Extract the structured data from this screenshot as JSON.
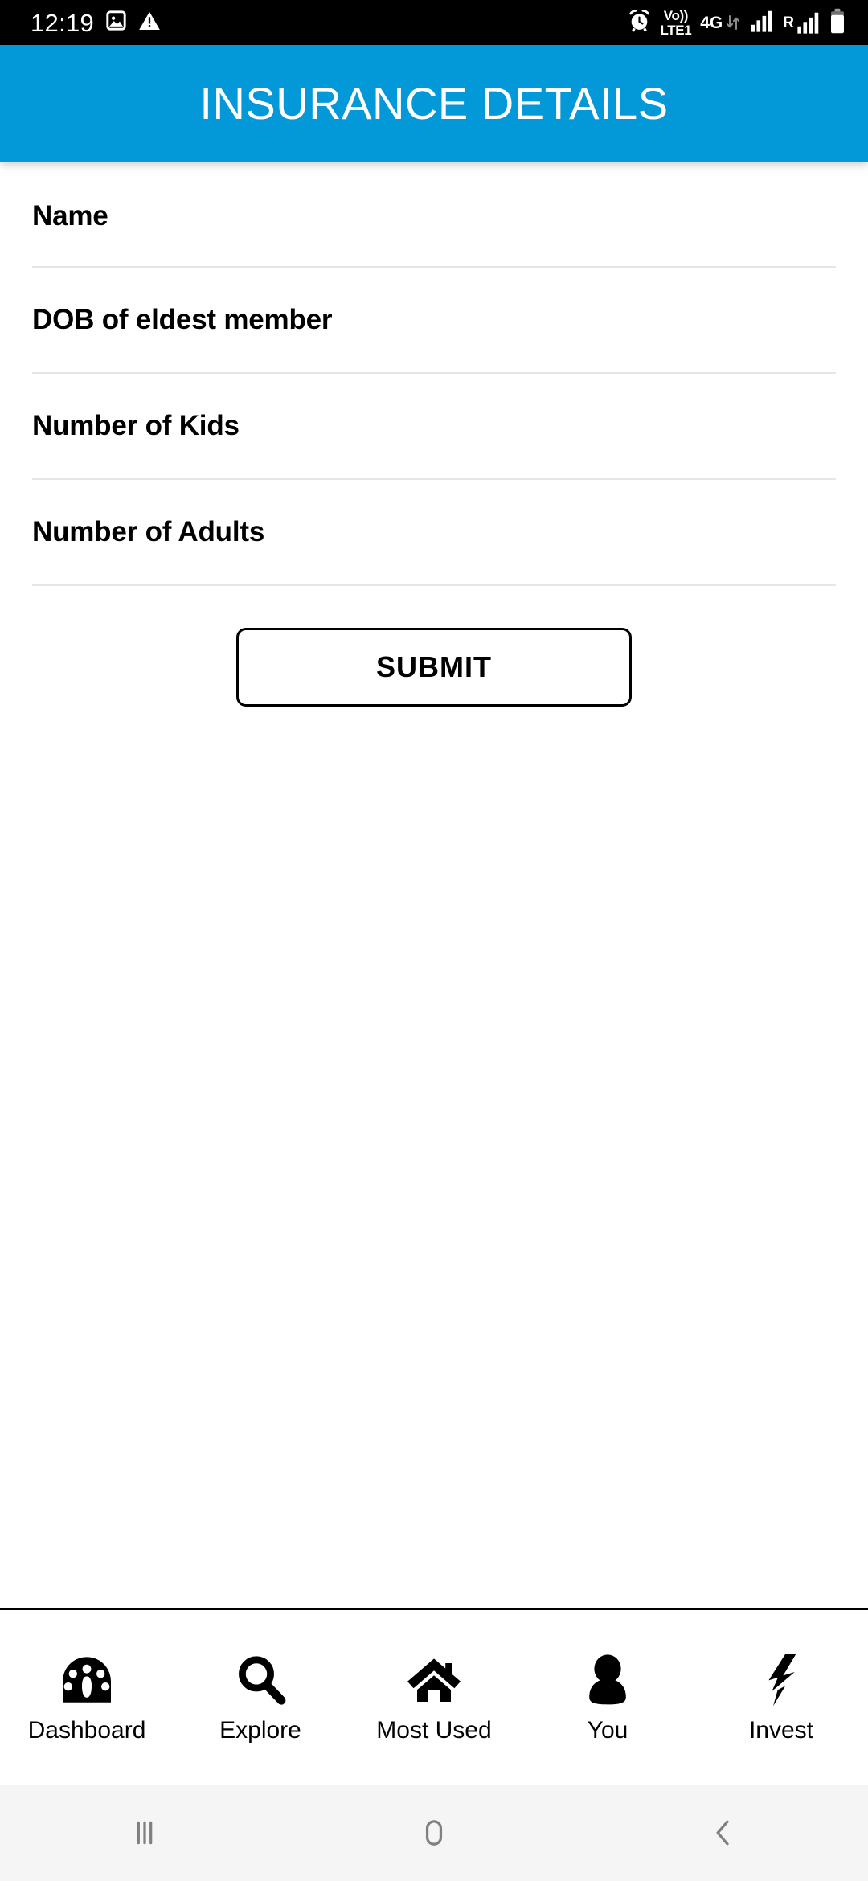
{
  "status_bar": {
    "time": "12:19",
    "left_icons": [
      {
        "name": "image-icon"
      },
      {
        "name": "warning-triangle-icon"
      }
    ],
    "right_icons": [
      {
        "name": "alarm-clock-icon"
      },
      {
        "name": "volte-icon",
        "top": "Vo))",
        "bottom": "LTE1"
      },
      {
        "name": "data-network-icon",
        "label": "4G"
      },
      {
        "name": "signal-bars-sim1-icon"
      },
      {
        "name": "roaming-signal-icon",
        "label": "R"
      },
      {
        "name": "battery-icon"
      }
    ]
  },
  "header": {
    "title": "INSURANCE DETAILS",
    "background_color": "#0398d8",
    "text_color": "#ffffff"
  },
  "form": {
    "fields": [
      {
        "label": "Name",
        "value": "",
        "placeholder": ""
      },
      {
        "label": "DOB of eldest member",
        "value": "",
        "placeholder": ""
      },
      {
        "label": "Number of Kids",
        "value": "",
        "placeholder": ""
      },
      {
        "label": "Number of Adults",
        "value": "",
        "placeholder": ""
      }
    ],
    "submit_label": "SUBMIT"
  },
  "bottom_nav": {
    "items": [
      {
        "label": "Dashboard",
        "icon": "speedometer-icon"
      },
      {
        "label": "Explore",
        "icon": "magnifier-icon"
      },
      {
        "label": "Most Used",
        "icon": "home-icon"
      },
      {
        "label": "You",
        "icon": "person-icon"
      },
      {
        "label": "Invest",
        "icon": "lightning-bolt-icon"
      }
    ]
  },
  "system_nav": {
    "buttons": [
      {
        "name": "recents-button"
      },
      {
        "name": "home-button"
      },
      {
        "name": "back-button"
      }
    ],
    "background_color": "#f5f5f5",
    "icon_color": "#808080"
  }
}
